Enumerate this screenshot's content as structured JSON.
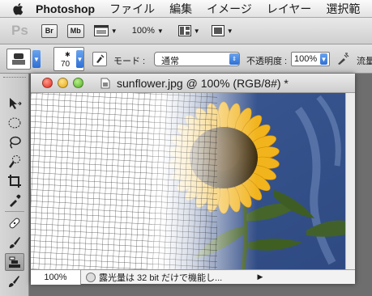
{
  "menubar": {
    "app_name": "Photoshop",
    "items": [
      "ファイル",
      "編集",
      "イメージ",
      "レイヤー",
      "選択範"
    ]
  },
  "appbar": {
    "logo": "Ps",
    "bridge_label": "Br",
    "minibridge_label": "Mb",
    "zoom": "100%"
  },
  "options": {
    "brush_size": "70",
    "mode_label": "モード :",
    "mode_value": "通常",
    "opacity_label": "不透明度 :",
    "opacity_value": "100%",
    "flow_label": "流量"
  },
  "document": {
    "title": "sunflower.jpg @ 100% (RGB/8#) *",
    "status_zoom": "100%",
    "status_text": "露光量は 32 bit だけで機能し..."
  },
  "colors": {
    "sky": "#3a5894",
    "petal": "#f2b41c",
    "center": "#4a3413",
    "leaf": "#3f5e22"
  }
}
